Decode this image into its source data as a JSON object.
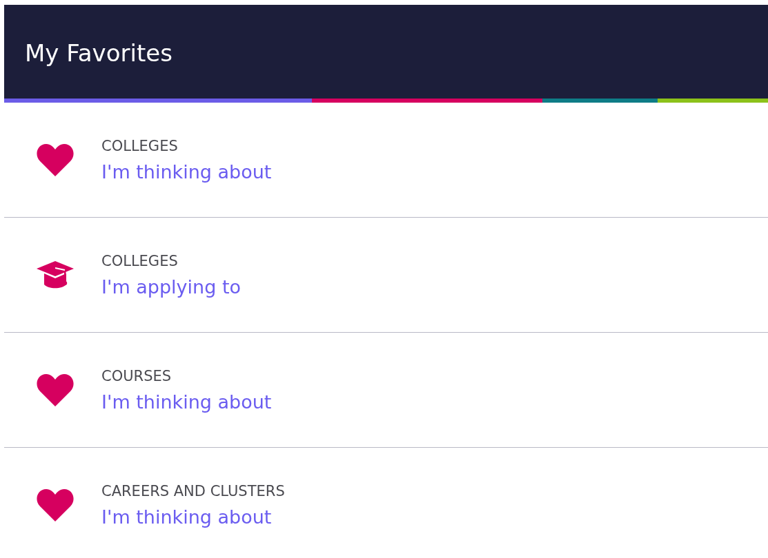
{
  "header": {
    "title": "My Favorites"
  },
  "items": [
    {
      "kind": "thinking",
      "category": "COLLEGES",
      "link": "I'm thinking about"
    },
    {
      "kind": "applying",
      "category": "COLLEGES",
      "link": "I'm applying to"
    },
    {
      "kind": "thinking",
      "category": "COURSES",
      "link": "I'm thinking about"
    },
    {
      "kind": "thinking",
      "category": "CAREERS AND CLUSTERS",
      "link": "I'm thinking about"
    }
  ]
}
